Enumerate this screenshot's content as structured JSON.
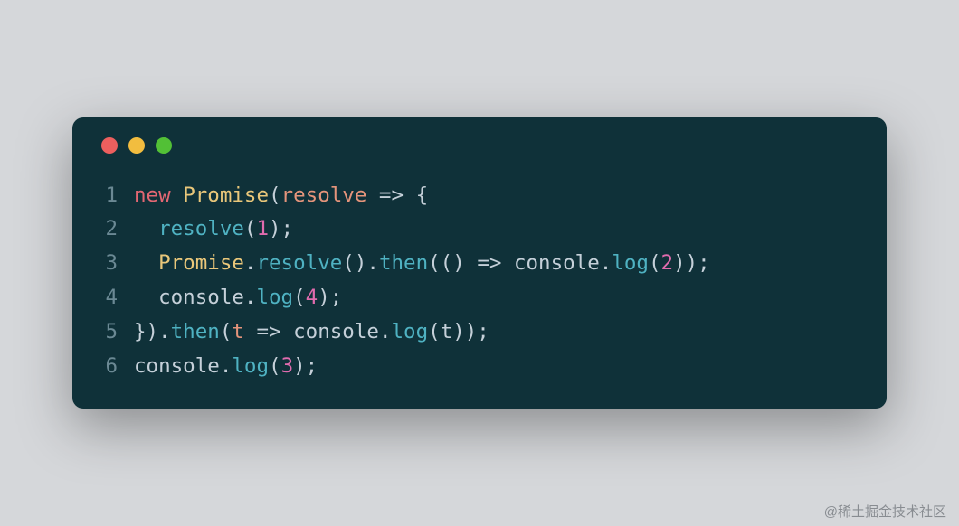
{
  "window": {
    "traffic_lights": [
      "red",
      "yellow",
      "green"
    ]
  },
  "code": {
    "lines": [
      {
        "num": "1",
        "tokens": [
          {
            "cls": "t-keyword",
            "text": "new"
          },
          {
            "cls": "t-punc",
            "text": " "
          },
          {
            "cls": "t-class",
            "text": "Promise"
          },
          {
            "cls": "t-punc",
            "text": "("
          },
          {
            "cls": "t-param",
            "text": "resolve"
          },
          {
            "cls": "t-arrow",
            "text": " => "
          },
          {
            "cls": "t-punc",
            "text": "{"
          }
        ]
      },
      {
        "num": "2",
        "tokens": [
          {
            "cls": "t-punc",
            "text": "  "
          },
          {
            "cls": "t-func",
            "text": "resolve"
          },
          {
            "cls": "t-punc",
            "text": "("
          },
          {
            "cls": "t-num",
            "text": "1"
          },
          {
            "cls": "t-punc",
            "text": ");"
          }
        ]
      },
      {
        "num": "3",
        "tokens": [
          {
            "cls": "t-punc",
            "text": "  "
          },
          {
            "cls": "t-class",
            "text": "Promise"
          },
          {
            "cls": "t-punc",
            "text": "."
          },
          {
            "cls": "t-method",
            "text": "resolve"
          },
          {
            "cls": "t-punc",
            "text": "()."
          },
          {
            "cls": "t-method",
            "text": "then"
          },
          {
            "cls": "t-punc",
            "text": "(() "
          },
          {
            "cls": "t-arrow",
            "text": "=>"
          },
          {
            "cls": "t-punc",
            "text": " "
          },
          {
            "cls": "t-ident",
            "text": "console"
          },
          {
            "cls": "t-punc",
            "text": "."
          },
          {
            "cls": "t-method",
            "text": "log"
          },
          {
            "cls": "t-punc",
            "text": "("
          },
          {
            "cls": "t-num",
            "text": "2"
          },
          {
            "cls": "t-punc",
            "text": "));"
          }
        ]
      },
      {
        "num": "4",
        "tokens": [
          {
            "cls": "t-punc",
            "text": "  "
          },
          {
            "cls": "t-ident",
            "text": "console"
          },
          {
            "cls": "t-punc",
            "text": "."
          },
          {
            "cls": "t-method",
            "text": "log"
          },
          {
            "cls": "t-punc",
            "text": "("
          },
          {
            "cls": "t-num",
            "text": "4"
          },
          {
            "cls": "t-punc",
            "text": ");"
          }
        ]
      },
      {
        "num": "5",
        "tokens": [
          {
            "cls": "t-punc",
            "text": "})."
          },
          {
            "cls": "t-method",
            "text": "then"
          },
          {
            "cls": "t-punc",
            "text": "("
          },
          {
            "cls": "t-param",
            "text": "t"
          },
          {
            "cls": "t-arrow",
            "text": " => "
          },
          {
            "cls": "t-ident",
            "text": "console"
          },
          {
            "cls": "t-punc",
            "text": "."
          },
          {
            "cls": "t-method",
            "text": "log"
          },
          {
            "cls": "t-punc",
            "text": "("
          },
          {
            "cls": "t-ident",
            "text": "t"
          },
          {
            "cls": "t-punc",
            "text": "));"
          }
        ]
      },
      {
        "num": "6",
        "tokens": [
          {
            "cls": "t-ident",
            "text": "console"
          },
          {
            "cls": "t-punc",
            "text": "."
          },
          {
            "cls": "t-method",
            "text": "log"
          },
          {
            "cls": "t-punc",
            "text": "("
          },
          {
            "cls": "t-num",
            "text": "3"
          },
          {
            "cls": "t-punc",
            "text": ");"
          }
        ]
      }
    ]
  },
  "watermark": "@稀土掘金技术社区"
}
